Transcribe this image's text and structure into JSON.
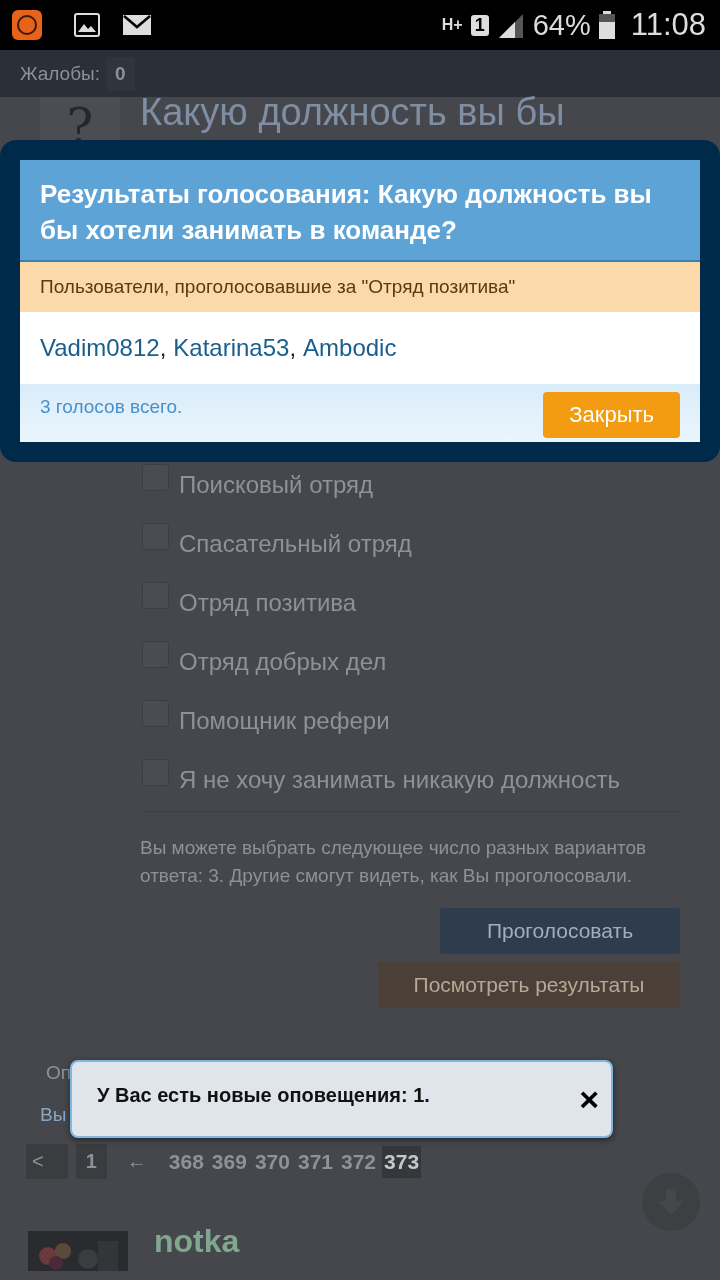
{
  "status_bar": {
    "battery": "64%",
    "time": "11:08",
    "network": "H+",
    "sim": "1"
  },
  "header": {
    "label": "Жалобы:",
    "count": "0"
  },
  "poll": {
    "icon": "?",
    "title": "Какую должность вы бы",
    "options": [
      {
        "label": "Поисковый отряд",
        "checked": false
      },
      {
        "label": "Спасательный отряд",
        "checked": false
      },
      {
        "label": "Отряд позитива",
        "checked": false
      },
      {
        "label": "Отряд добрых дел",
        "checked": false
      },
      {
        "label": "Помощник рефери",
        "checked": false
      },
      {
        "label": "Я не хочу занимать никакую должность",
        "checked": false
      }
    ],
    "note": "Вы можете выбрать следующее число разных вариантов ответа: 3. Другие смогут видеть, как Вы проголосовали.",
    "vote_button": "Проголосовать",
    "results_button": "Посмотреть результаты"
  },
  "below": {
    "line_1": "Оп",
    "line_2": "Вы"
  },
  "pagination": {
    "prev": "<",
    "first": "1",
    "ellipsis": "←",
    "pages": [
      {
        "label": "368",
        "selected": false
      },
      {
        "label": "369",
        "selected": false
      },
      {
        "label": "370",
        "selected": false
      },
      {
        "label": "371",
        "selected": false
      },
      {
        "label": "372",
        "selected": false
      },
      {
        "label": "373",
        "selected": true
      }
    ]
  },
  "post": {
    "author": "notka"
  },
  "modal": {
    "title": "Результаты голосования: Какую должность вы бы хотели занимать в команде?",
    "subtitle": "Пользователи, проголосовавшие за \"Отряд позитива\"",
    "voters": [
      "Vadim0812",
      "Katarina53",
      "Ambodic"
    ],
    "separator": ",",
    "total": "3 голосов всего.",
    "close_button": "Закрыть"
  },
  "toast": {
    "text": "У Вас есть новые оповещения: 1.",
    "close": "×"
  }
}
